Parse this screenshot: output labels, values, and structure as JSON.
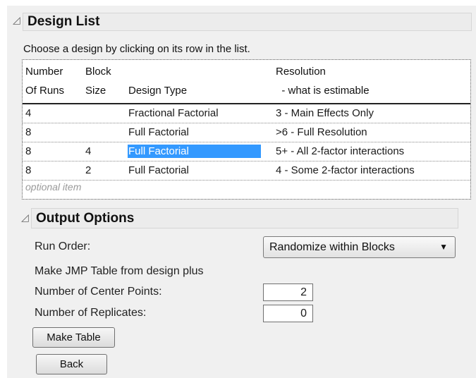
{
  "design_list": {
    "title": "Design List",
    "instruction": "Choose a design by clicking on its row in the list.",
    "columns": {
      "runs": [
        "Number",
        "Of Runs"
      ],
      "block": [
        "Block",
        "Size"
      ],
      "type": [
        "",
        "Design Type"
      ],
      "resolution": [
        "Resolution",
        "  - what is estimable"
      ]
    },
    "rows": [
      {
        "runs": "4",
        "block": "",
        "type": "Fractional Factorial",
        "resolution": "3 - Main Effects Only"
      },
      {
        "runs": "8",
        "block": "",
        "type": "Full Factorial",
        "resolution": ">6 - Full Resolution"
      },
      {
        "runs": "8",
        "block": "4",
        "type": "Full Factorial",
        "resolution": "5+ - All 2-factor interactions"
      },
      {
        "runs": "8",
        "block": "2",
        "type": "Full Factorial",
        "resolution": "4 - Some 2-factor interactions"
      }
    ],
    "selected_row": 2,
    "optional_item": "optional item"
  },
  "output_options": {
    "title": "Output Options",
    "run_order_label": "Run Order:",
    "run_order_value": "Randomize within Blocks",
    "make_table_from": "Make JMP Table from design plus",
    "center_points_label": "Number of Center Points:",
    "center_points_value": "2",
    "replicates_label": "Number of Replicates:",
    "replicates_value": "0",
    "make_table_button": "Make Table",
    "back_button": "Back"
  },
  "icons": {
    "disclosure": "disclosure-triangle-icon",
    "dropdown_arrow": "caret-down-icon"
  },
  "colors": {
    "selection": "#3399ff",
    "header_bg": "#ececec",
    "panel_bg": "#f0f0f0"
  }
}
